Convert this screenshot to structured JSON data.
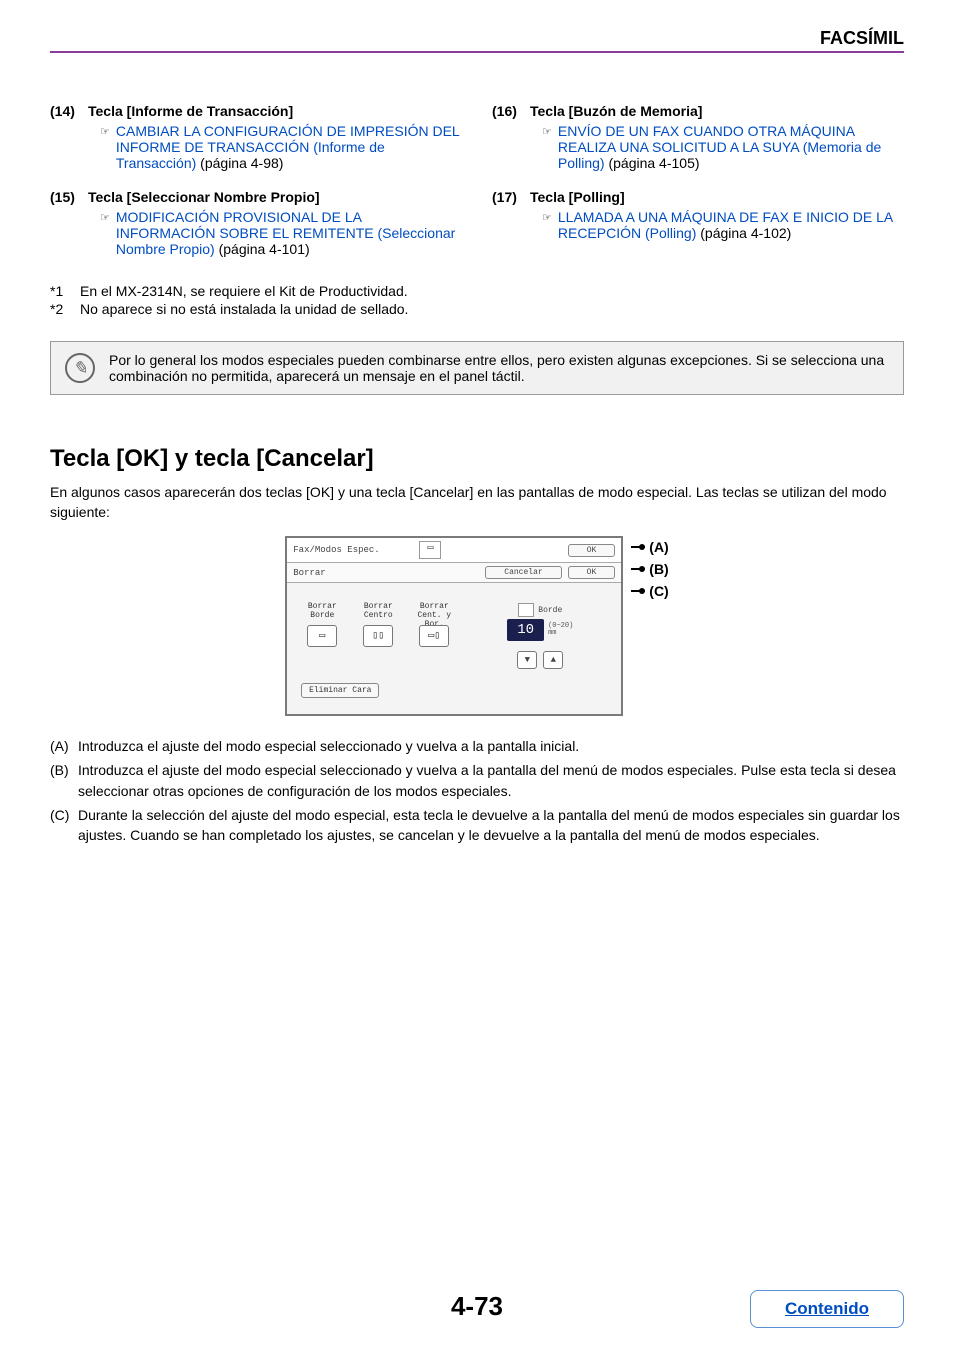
{
  "header": {
    "title": "FACSÍMIL"
  },
  "left_items": [
    {
      "num": "(14)",
      "title": "Tecla [Informe de Transacción]",
      "link": "CAMBIAR LA CONFIGURACIÓN DE IMPRESIÓN DEL INFORME DE TRANSACCIÓN (Informe de Transacción)",
      "suffix": " (página 4-98)"
    },
    {
      "num": "(15)",
      "title": "Tecla [Seleccionar Nombre Propio]",
      "link": "MODIFICACIÓN PROVISIONAL DE LA INFORMACIÓN SOBRE EL REMITENTE (Seleccionar Nombre Propio)",
      "suffix": " (página 4-101)"
    }
  ],
  "right_items": [
    {
      "num": "(16)",
      "title": "Tecla [Buzón de Memoria]",
      "link": "ENVÍO DE UN FAX CUANDO OTRA MÁQUINA REALIZA UNA SOLICITUD A LA SUYA (Memoria de Polling)",
      "suffix": " (página 4-105)"
    },
    {
      "num": "(17)",
      "title": "Tecla [Polling]",
      "link": "LLAMADA A UNA MÁQUINA DE FAX E INICIO DE LA RECEPCIÓN (Polling)",
      "suffix": " (página 4-102)"
    }
  ],
  "footnotes": [
    {
      "num": "*1",
      "text": "En el MX-2314N, se requiere el Kit de Productividad."
    },
    {
      "num": "*2",
      "text": "No aparece si no está instalada la unidad de sellado."
    }
  ],
  "info_note": "Por lo general los modos especiales pueden combinarse entre ellos, pero existen algunas excepciones. Si se selecciona una combinación no permitida, aparecerá un mensaje en el panel táctil.",
  "section": {
    "heading": "Tecla [OK] y tecla [Cancelar]",
    "intro": "En algunos casos aparecerán dos teclas [OK] y una tecla [Cancelar] en las pantallas de modo especial. Las teclas se utilizan del modo siguiente:"
  },
  "panel": {
    "row1_title": "Fax/Modos Espec.",
    "row1_ok": "OK",
    "row2_title": "Borrar",
    "row2_cancel": "Cancelar",
    "row2_ok": "OK",
    "opt1_l1": "Borrar",
    "opt1_l2": "Borde",
    "opt2_l1": "Borrar",
    "opt2_l2": "Centro",
    "opt3_l1": "Borrar",
    "opt3_l2": "Cent. y Bor.",
    "right_label": "Borde",
    "value": "10",
    "range": "(0~20)",
    "range_unit": "mm",
    "elim": "Eliminar Cara"
  },
  "callouts": {
    "a": "(A)",
    "b": "(B)",
    "c": "(C)"
  },
  "abc_list": [
    {
      "lab": "(A)",
      "text": "Introduzca el ajuste del modo especial seleccionado y vuelva a la pantalla inicial."
    },
    {
      "lab": "(B)",
      "text": "Introduzca el ajuste del modo especial seleccionado y vuelva a la pantalla del menú de modos especiales. Pulse esta tecla si desea seleccionar otras opciones de configuración de los modos especiales."
    },
    {
      "lab": "(C)",
      "text": "Durante la selección del ajuste del modo especial, esta tecla le devuelve a la pantalla del menú de modos especiales sin guardar los ajustes. Cuando se han completado los ajustes, se cancelan y le devuelve a la pantalla del menú de modos especiales."
    }
  ],
  "footer": {
    "page": "4-73",
    "contents": "Contenido"
  }
}
